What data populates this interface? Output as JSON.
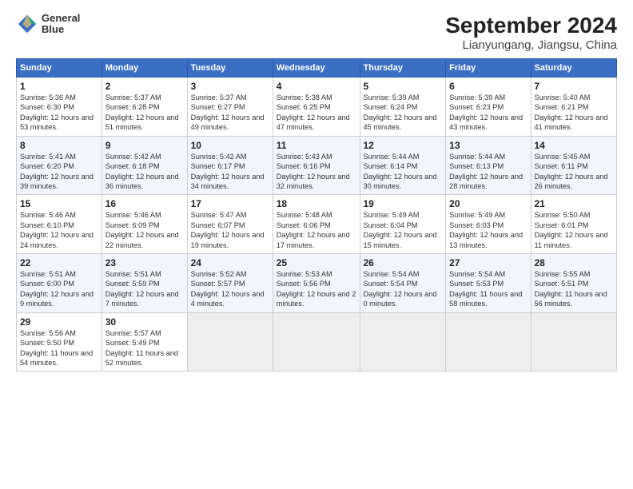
{
  "logo": {
    "line1": "General",
    "line2": "Blue"
  },
  "title": "September 2024",
  "subtitle": "Lianyungang, Jiangsu, China",
  "days_of_week": [
    "Sunday",
    "Monday",
    "Tuesday",
    "Wednesday",
    "Thursday",
    "Friday",
    "Saturday"
  ],
  "weeks": [
    [
      {
        "day": "1",
        "rise": "5:36 AM",
        "set": "6:30 PM",
        "daylight": "12 hours and 53 minutes."
      },
      {
        "day": "2",
        "rise": "5:37 AM",
        "set": "6:28 PM",
        "daylight": "12 hours and 51 minutes."
      },
      {
        "day": "3",
        "rise": "5:37 AM",
        "set": "6:27 PM",
        "daylight": "12 hours and 49 minutes."
      },
      {
        "day": "4",
        "rise": "5:38 AM",
        "set": "6:25 PM",
        "daylight": "12 hours and 47 minutes."
      },
      {
        "day": "5",
        "rise": "5:39 AM",
        "set": "6:24 PM",
        "daylight": "12 hours and 45 minutes."
      },
      {
        "day": "6",
        "rise": "5:39 AM",
        "set": "6:23 PM",
        "daylight": "12 hours and 43 minutes."
      },
      {
        "day": "7",
        "rise": "5:40 AM",
        "set": "6:21 PM",
        "daylight": "12 hours and 41 minutes."
      }
    ],
    [
      {
        "day": "8",
        "rise": "5:41 AM",
        "set": "6:20 PM",
        "daylight": "12 hours and 39 minutes."
      },
      {
        "day": "9",
        "rise": "5:42 AM",
        "set": "6:18 PM",
        "daylight": "12 hours and 36 minutes."
      },
      {
        "day": "10",
        "rise": "5:42 AM",
        "set": "6:17 PM",
        "daylight": "12 hours and 34 minutes."
      },
      {
        "day": "11",
        "rise": "5:43 AM",
        "set": "6:16 PM",
        "daylight": "12 hours and 32 minutes."
      },
      {
        "day": "12",
        "rise": "5:44 AM",
        "set": "6:14 PM",
        "daylight": "12 hours and 30 minutes."
      },
      {
        "day": "13",
        "rise": "5:44 AM",
        "set": "6:13 PM",
        "daylight": "12 hours and 28 minutes."
      },
      {
        "day": "14",
        "rise": "5:45 AM",
        "set": "6:11 PM",
        "daylight": "12 hours and 26 minutes."
      }
    ],
    [
      {
        "day": "15",
        "rise": "5:46 AM",
        "set": "6:10 PM",
        "daylight": "12 hours and 24 minutes."
      },
      {
        "day": "16",
        "rise": "5:46 AM",
        "set": "6:09 PM",
        "daylight": "12 hours and 22 minutes."
      },
      {
        "day": "17",
        "rise": "5:47 AM",
        "set": "6:07 PM",
        "daylight": "12 hours and 19 minutes."
      },
      {
        "day": "18",
        "rise": "5:48 AM",
        "set": "6:06 PM",
        "daylight": "12 hours and 17 minutes."
      },
      {
        "day": "19",
        "rise": "5:49 AM",
        "set": "6:04 PM",
        "daylight": "12 hours and 15 minutes."
      },
      {
        "day": "20",
        "rise": "5:49 AM",
        "set": "6:03 PM",
        "daylight": "12 hours and 13 minutes."
      },
      {
        "day": "21",
        "rise": "5:50 AM",
        "set": "6:01 PM",
        "daylight": "12 hours and 11 minutes."
      }
    ],
    [
      {
        "day": "22",
        "rise": "5:51 AM",
        "set": "6:00 PM",
        "daylight": "12 hours and 9 minutes."
      },
      {
        "day": "23",
        "rise": "5:51 AM",
        "set": "5:59 PM",
        "daylight": "12 hours and 7 minutes."
      },
      {
        "day": "24",
        "rise": "5:52 AM",
        "set": "5:57 PM",
        "daylight": "12 hours and 4 minutes."
      },
      {
        "day": "25",
        "rise": "5:53 AM",
        "set": "5:56 PM",
        "daylight": "12 hours and 2 minutes."
      },
      {
        "day": "26",
        "rise": "5:54 AM",
        "set": "5:54 PM",
        "daylight": "12 hours and 0 minutes."
      },
      {
        "day": "27",
        "rise": "5:54 AM",
        "set": "5:53 PM",
        "daylight": "11 hours and 58 minutes."
      },
      {
        "day": "28",
        "rise": "5:55 AM",
        "set": "5:51 PM",
        "daylight": "11 hours and 56 minutes."
      }
    ],
    [
      {
        "day": "29",
        "rise": "5:56 AM",
        "set": "5:50 PM",
        "daylight": "11 hours and 54 minutes."
      },
      {
        "day": "30",
        "rise": "5:57 AM",
        "set": "5:49 PM",
        "daylight": "11 hours and 52 minutes."
      },
      null,
      null,
      null,
      null,
      null
    ]
  ]
}
